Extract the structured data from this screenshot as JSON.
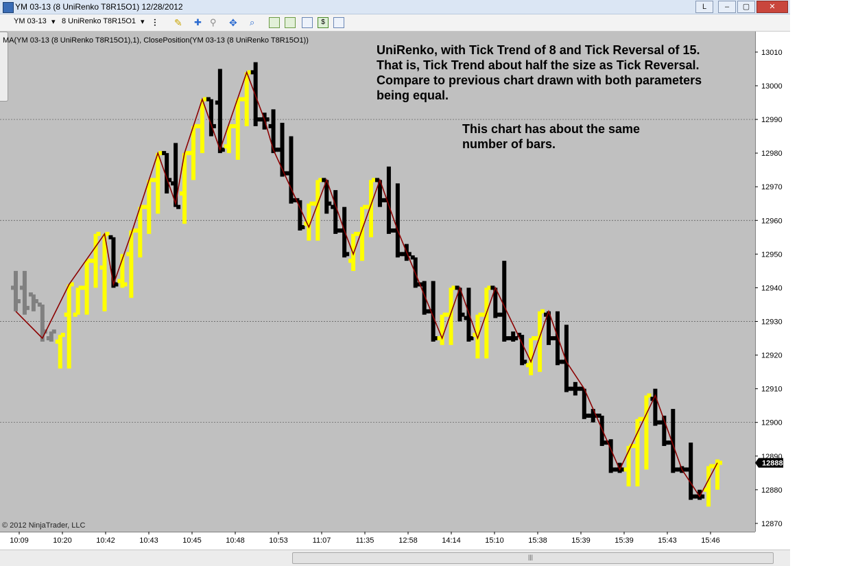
{
  "window": {
    "title": "YM 03-13 (8 UniRenko T8R15O1)  12/28/2012",
    "buttons": [
      "L",
      "–",
      "▢",
      "✕"
    ]
  },
  "toolbar": {
    "instrument": "YM 03-13",
    "bartype": "8 UniRenko T8R15O1"
  },
  "indicator_label": "MA(YM 03-13 (8 UniRenko T8R15O1),1), ClosePosition(YM 03-13 (8 UniRenko T8R15O1))",
  "annotations": {
    "note1": "UniRenko, with Tick Trend        of 8 and Tick Reversal of 15. That is, Tick Trend about half the size as Tick Reversal. Compare to previous chart drawn with both parameters being equal.",
    "note2": "This chart has about the same number of bars."
  },
  "copyright": "© 2012 NinjaTrader, LLC",
  "colors": {
    "up": "#ffff00",
    "down": "#000000",
    "historical": "#808080",
    "line": "#8b0000",
    "plot_bg": "#c0c0c0"
  },
  "chart_data": {
    "type": "line",
    "ylim": [
      12867,
      13015
    ],
    "y_ticks": [
      13010,
      13000,
      12990,
      12980,
      12970,
      12960,
      12950,
      12940,
      12930,
      12920,
      12910,
      12900,
      12890,
      12880,
      12870
    ],
    "gridlines": [
      12990,
      12960,
      12930,
      12900
    ],
    "x_labels": [
      "10:09",
      "10:20",
      "10:42",
      "10:43",
      "10:45",
      "10:48",
      "10:53",
      "11:07",
      "11:35",
      "12:58",
      "14:14",
      "15:10",
      "15:38",
      "15:39",
      "15:39",
      "15:43",
      "15:46"
    ],
    "last_price": 12888,
    "bars": [
      {
        "o": 12940,
        "c": 12936,
        "h": 12945,
        "l": 12933,
        "d": "x"
      },
      {
        "o": 12940,
        "c": 12934,
        "h": 12945,
        "l": 12932,
        "d": "x"
      },
      {
        "o": 12938,
        "c": 12936,
        "h": 12938,
        "l": 12933,
        "d": "x"
      },
      {
        "o": 12935,
        "c": 12927,
        "h": 12935,
        "l": 12924,
        "d": "x"
      },
      {
        "o": 12925,
        "c": 12927,
        "h": 12927,
        "l": 12924,
        "d": "x"
      },
      {
        "o": 12924,
        "c": 12926,
        "h": 12926,
        "l": 12916,
        "d": "u"
      },
      {
        "o": 12932,
        "c": 12941,
        "h": 12941,
        "l": 12916,
        "d": "u"
      },
      {
        "o": 12932,
        "c": 12940,
        "h": 12940,
        "l": 12932,
        "d": "u"
      },
      {
        "o": 12940,
        "c": 12948,
        "h": 12948,
        "l": 12932,
        "d": "u"
      },
      {
        "o": 12948,
        "c": 12956,
        "h": 12956,
        "l": 12940,
        "d": "u"
      },
      {
        "o": 12946,
        "c": 12956,
        "h": 12956,
        "l": 12933,
        "d": "u"
      },
      {
        "o": 12955,
        "c": 12941,
        "h": 12955,
        "l": 12940,
        "d": "d"
      },
      {
        "o": 12942,
        "c": 12941,
        "h": 12950,
        "l": 12940,
        "d": "u"
      },
      {
        "o": 12950,
        "c": 12957,
        "h": 12957,
        "l": 12937,
        "d": "u"
      },
      {
        "o": 12957,
        "c": 12964,
        "h": 12964,
        "l": 12949,
        "d": "u"
      },
      {
        "o": 12964,
        "c": 12972,
        "h": 12972,
        "l": 12956,
        "d": "u"
      },
      {
        "o": 12972,
        "c": 12980,
        "h": 12980,
        "l": 12962,
        "d": "u"
      },
      {
        "o": 12980,
        "c": 12972,
        "h": 12980,
        "l": 12968,
        "d": "d"
      },
      {
        "o": 12971,
        "c": 12964,
        "h": 12983,
        "l": 12964,
        "d": "d"
      },
      {
        "o": 12968,
        "c": 12980,
        "h": 12980,
        "l": 12959,
        "d": "u"
      },
      {
        "o": 12980,
        "c": 12988,
        "h": 12988,
        "l": 12972,
        "d": "u"
      },
      {
        "o": 12988,
        "c": 12996,
        "h": 12996,
        "l": 12980,
        "d": "u"
      },
      {
        "o": 12996,
        "c": 12988,
        "h": 12996,
        "l": 12985,
        "d": "d"
      },
      {
        "o": 12995,
        "c": 12981,
        "h": 13005,
        "l": 12980,
        "d": "d"
      },
      {
        "o": 12982,
        "c": 12988,
        "h": 12988,
        "l": 12980,
        "d": "u"
      },
      {
        "o": 12988,
        "c": 12996,
        "h": 12996,
        "l": 12978,
        "d": "u"
      },
      {
        "o": 12996,
        "c": 13004,
        "h": 13004,
        "l": 12988,
        "d": "u"
      },
      {
        "o": 13004,
        "c": 12990,
        "h": 13007,
        "l": 12988,
        "d": "d"
      },
      {
        "o": 12990,
        "c": 12990,
        "h": 12992,
        "l": 12987,
        "d": "d"
      },
      {
        "o": 12988,
        "c": 12981,
        "h": 12993,
        "l": 12980,
        "d": "d"
      },
      {
        "o": 12981,
        "c": 12974,
        "h": 12989,
        "l": 12973,
        "d": "d"
      },
      {
        "o": 12974,
        "c": 12966,
        "h": 12985,
        "l": 12965,
        "d": "d"
      },
      {
        "o": 12966,
        "c": 12958,
        "h": 12966,
        "l": 12957,
        "d": "d"
      },
      {
        "o": 12959,
        "c": 12965,
        "h": 12965,
        "l": 12954,
        "d": "u"
      },
      {
        "o": 12965,
        "c": 12972,
        "h": 12972,
        "l": 12954,
        "d": "u"
      },
      {
        "o": 12972,
        "c": 12965,
        "h": 12972,
        "l": 12962,
        "d": "d"
      },
      {
        "o": 12964,
        "c": 12957,
        "h": 12969,
        "l": 12956,
        "d": "d"
      },
      {
        "o": 12957,
        "c": 12950,
        "h": 12964,
        "l": 12949,
        "d": "d"
      },
      {
        "o": 12948,
        "c": 12956,
        "h": 12956,
        "l": 12945,
        "d": "u"
      },
      {
        "o": 12956,
        "c": 12964,
        "h": 12964,
        "l": 12948,
        "d": "u"
      },
      {
        "o": 12964,
        "c": 12972,
        "h": 12972,
        "l": 12955,
        "d": "u"
      },
      {
        "o": 12972,
        "c": 12966,
        "h": 12972,
        "l": 12964,
        "d": "d"
      },
      {
        "o": 12966,
        "c": 12957,
        "h": 12976,
        "l": 12956,
        "d": "d"
      },
      {
        "o": 12957,
        "c": 12950,
        "h": 12971,
        "l": 12949,
        "d": "d"
      },
      {
        "o": 12950,
        "c": 12950,
        "h": 12953,
        "l": 12948,
        "d": "d"
      },
      {
        "o": 12949,
        "c": 12941,
        "h": 12949,
        "l": 12940,
        "d": "d"
      },
      {
        "o": 12941,
        "c": 12933,
        "h": 12942,
        "l": 12932,
        "d": "d"
      },
      {
        "o": 12933,
        "c": 12925,
        "h": 12942,
        "l": 12924,
        "d": "d"
      },
      {
        "o": 12925,
        "c": 12932,
        "h": 12932,
        "l": 12923,
        "d": "u"
      },
      {
        "o": 12932,
        "c": 12940,
        "h": 12940,
        "l": 12923,
        "d": "u"
      },
      {
        "o": 12940,
        "c": 12932,
        "h": 12940,
        "l": 12930,
        "d": "d"
      },
      {
        "o": 12931,
        "c": 12925,
        "h": 12940,
        "l": 12924,
        "d": "d"
      },
      {
        "o": 12926,
        "c": 12932,
        "h": 12932,
        "l": 12919,
        "d": "u"
      },
      {
        "o": 12932,
        "c": 12940,
        "h": 12940,
        "l": 12919,
        "d": "u"
      },
      {
        "o": 12940,
        "c": 12932,
        "h": 12940,
        "l": 12931,
        "d": "d"
      },
      {
        "o": 12932,
        "c": 12925,
        "h": 12948,
        "l": 12924,
        "d": "d"
      },
      {
        "o": 12925,
        "c": 12925,
        "h": 12927,
        "l": 12924,
        "d": "d"
      },
      {
        "o": 12926,
        "c": 12918,
        "h": 12926,
        "l": 12917,
        "d": "d"
      },
      {
        "o": 12917,
        "c": 12925,
        "h": 12925,
        "l": 12914,
        "d": "u"
      },
      {
        "o": 12925,
        "c": 12933,
        "h": 12933,
        "l": 12915,
        "d": "u"
      },
      {
        "o": 12932,
        "c": 12925,
        "h": 12933,
        "l": 12923,
        "d": "d"
      },
      {
        "o": 12925,
        "c": 12918,
        "h": 12933,
        "l": 12917,
        "d": "d"
      },
      {
        "o": 12918,
        "c": 12910,
        "h": 12929,
        "l": 12909,
        "d": "d"
      },
      {
        "o": 12910,
        "c": 12910,
        "h": 12912,
        "l": 12908,
        "d": "d"
      },
      {
        "o": 12910,
        "c": 12902,
        "h": 12910,
        "l": 12901,
        "d": "d"
      },
      {
        "o": 12902,
        "c": 12902,
        "h": 12904,
        "l": 12900,
        "d": "d"
      },
      {
        "o": 12902,
        "c": 12894,
        "h": 12902,
        "l": 12893,
        "d": "d"
      },
      {
        "o": 12894,
        "c": 12886,
        "h": 12895,
        "l": 12885,
        "d": "d"
      },
      {
        "o": 12886,
        "c": 12886,
        "h": 12888,
        "l": 12885,
        "d": "d"
      },
      {
        "o": 12886,
        "c": 12893,
        "h": 12893,
        "l": 12881,
        "d": "u"
      },
      {
        "o": 12893,
        "c": 12901,
        "h": 12901,
        "l": 12881,
        "d": "u"
      },
      {
        "o": 12901,
        "c": 12908,
        "h": 12908,
        "l": 12886,
        "d": "u"
      },
      {
        "o": 12907,
        "c": 12900,
        "h": 12910,
        "l": 12899,
        "d": "d"
      },
      {
        "o": 12900,
        "c": 12894,
        "h": 12902,
        "l": 12893,
        "d": "d"
      },
      {
        "o": 12894,
        "c": 12886,
        "h": 12904,
        "l": 12885,
        "d": "d"
      },
      {
        "o": 12886,
        "c": 12886,
        "h": 12887,
        "l": 12885,
        "d": "d"
      },
      {
        "o": 12886,
        "c": 12878,
        "h": 12894,
        "l": 12877,
        "d": "d"
      },
      {
        "o": 12878,
        "c": 12878,
        "h": 12880,
        "l": 12877,
        "d": "d"
      },
      {
        "o": 12880,
        "c": 12887,
        "h": 12887,
        "l": 12875,
        "d": "u"
      },
      {
        "o": 12887,
        "c": 12888,
        "h": 12889,
        "l": 12880,
        "d": "u"
      }
    ],
    "line_points": [
      [
        0,
        12933
      ],
      [
        3,
        12925
      ],
      [
        6,
        12941
      ],
      [
        10,
        12956
      ],
      [
        11,
        12941
      ],
      [
        13,
        12956
      ],
      [
        16,
        12980
      ],
      [
        18,
        12965
      ],
      [
        19,
        12980
      ],
      [
        21,
        12996
      ],
      [
        23,
        12981
      ],
      [
        26,
        13004
      ],
      [
        28,
        12990
      ],
      [
        29,
        12981
      ],
      [
        33,
        12958
      ],
      [
        35,
        12972
      ],
      [
        37,
        12957
      ],
      [
        38,
        12950
      ],
      [
        41,
        12972
      ],
      [
        43,
        12957
      ],
      [
        48,
        12925
      ],
      [
        50,
        12940
      ],
      [
        52,
        12925
      ],
      [
        54,
        12940
      ],
      [
        58,
        12918
      ],
      [
        60,
        12933
      ],
      [
        62,
        12918
      ],
      [
        64,
        12910
      ],
      [
        68,
        12886
      ],
      [
        72,
        12908
      ],
      [
        75,
        12886
      ],
      [
        77,
        12878
      ],
      [
        79,
        12888
      ]
    ]
  }
}
